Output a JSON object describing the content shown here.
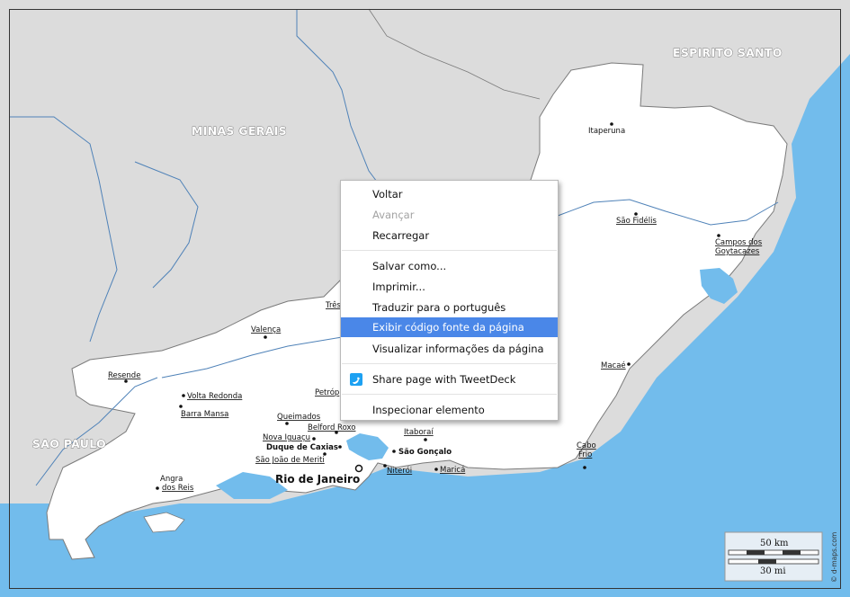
{
  "map": {
    "states": {
      "minas_gerais": "MINAS GERAIS",
      "espirito_santo": "ESPIRITO SANTO",
      "sao_paulo": "SAO PAULO"
    },
    "cities": {
      "itaperuna": "Itaperuna",
      "sao_fidelis": "São Fidélis",
      "campos_1": "Campos dos",
      "campos_2": "Goytacazes",
      "macae": "Macaé",
      "cabo_frio_1": "Cabo",
      "cabo_frio_2": "Frio",
      "tres_rios": "Três",
      "valenca": "Valença",
      "resende": "Resende",
      "volta_redonda": "Volta Redonda",
      "barra_mansa": "Barra Mansa",
      "petropolis": "Petróp",
      "queimados": "Queimados",
      "belford_roxo": "Belford Roxo",
      "nova_iguacu": "Nova Iguaçu",
      "duque_de_caxias": "Duque de Caxias",
      "sao_joao_de_meriti": "São João de Meriti",
      "rio_de_janeiro": "Rio de Janeiro",
      "itaborai": "Itaboraí",
      "sao_goncalo": "São Gonçalo",
      "niteroi": "Niterói",
      "marica": "Maricá",
      "angra_1": "Angra",
      "angra_2": "dos Reis"
    },
    "scale": {
      "km": "50 km",
      "mi": "30 mi"
    },
    "credit": "© d-maps.com",
    "colors": {
      "sea": "#72bcec",
      "land": "#ffffff",
      "neighbor": "#dcdcdc",
      "river": "#4f82b8",
      "border": "#7a7a7a"
    }
  },
  "context_menu": {
    "items": {
      "back": "Voltar",
      "forward": "Avançar",
      "reload": "Recarregar",
      "save_as": "Salvar como...",
      "print": "Imprimir...",
      "translate": "Traduzir para o português",
      "view_source": "Exibir código fonte da página",
      "page_info": "Visualizar informações da página",
      "tweetdeck": "Share page with TweetDeck",
      "inspect": "Inspecionar elemento"
    },
    "highlighted": "view_source",
    "highlight_color": "#4a87e8"
  }
}
